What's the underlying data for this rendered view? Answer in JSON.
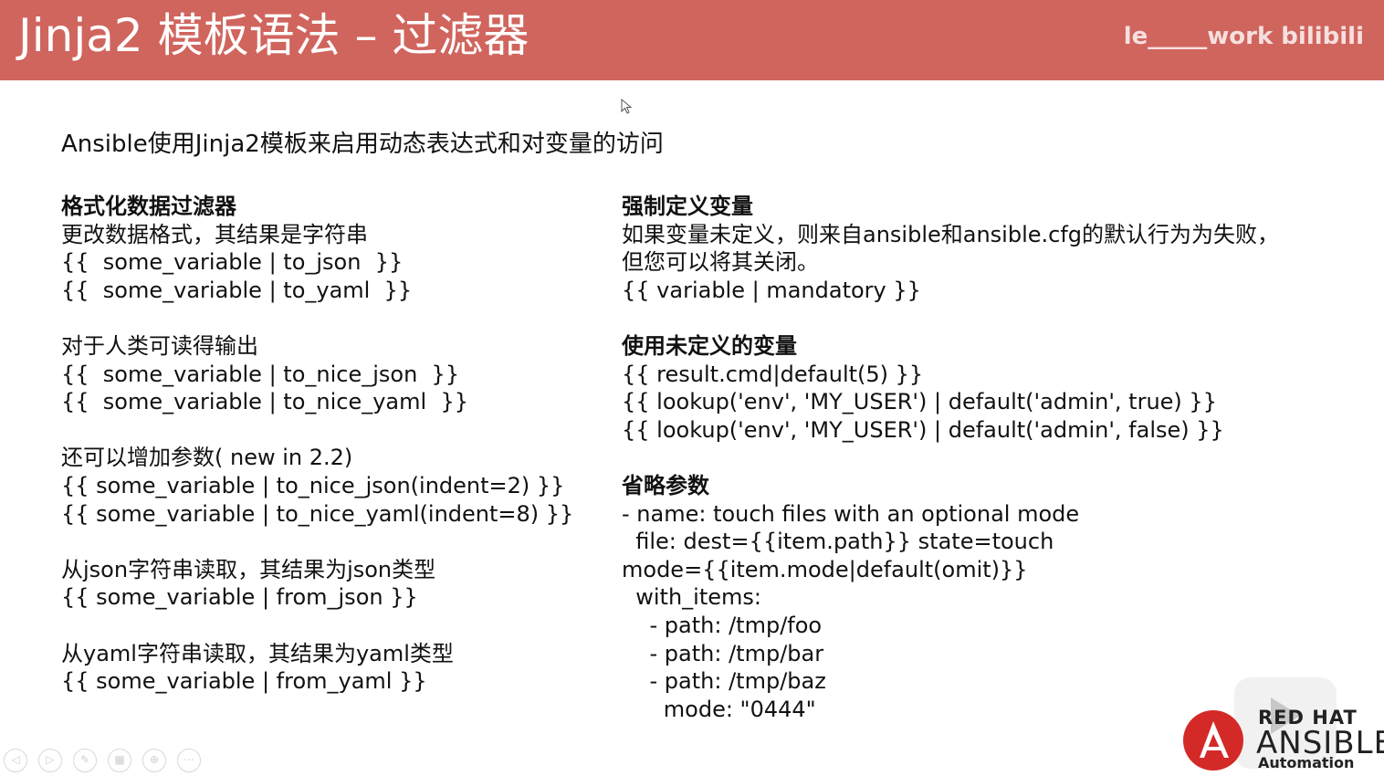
{
  "header": {
    "title": "Jinja2 模板语法 – 过滤器",
    "watermark": "le_____work bilibili",
    "background_color": "#d0655e"
  },
  "intro": "Ansible使用Jinja2模板来启用动态表达式和对变量的访问",
  "left_column": [
    {
      "text": "格式化数据过滤器",
      "kind": "heading"
    },
    {
      "text": "更改数据格式，其结果是字符串",
      "kind": "text"
    },
    {
      "text": "{{  some_variable | to_json  }}",
      "kind": "text"
    },
    {
      "text": "{{  some_variable | to_yaml  }}",
      "kind": "text"
    },
    {
      "text": "",
      "kind": "gap"
    },
    {
      "text": "对于人类可读得输出",
      "kind": "text"
    },
    {
      "text": "{{  some_variable | to_nice_json  }}",
      "kind": "text"
    },
    {
      "text": "{{  some_variable | to_nice_yaml  }}",
      "kind": "text"
    },
    {
      "text": "",
      "kind": "gap"
    },
    {
      "text": "还可以增加参数( new in 2.2)",
      "kind": "text"
    },
    {
      "text": "{{ some_variable | to_nice_json(indent=2) }}",
      "kind": "text"
    },
    {
      "text": "{{ some_variable | to_nice_yaml(indent=8) }}",
      "kind": "text"
    },
    {
      "text": "",
      "kind": "gap"
    },
    {
      "text": "从json字符串读取，其结果为json类型",
      "kind": "text"
    },
    {
      "text": "{{ some_variable | from_json }}",
      "kind": "text"
    },
    {
      "text": "",
      "kind": "gap"
    },
    {
      "text": "从yaml字符串读取，其结果为yaml类型",
      "kind": "text"
    },
    {
      "text": "{{ some_variable | from_yaml }}",
      "kind": "text"
    }
  ],
  "right_column": [
    {
      "text": "强制定义变量",
      "kind": "heading"
    },
    {
      "text": "如果变量未定义，则来自ansible和ansible.cfg的默认行为为失败，",
      "kind": "text"
    },
    {
      "text": "但您可以将其关闭。",
      "kind": "text"
    },
    {
      "text": "{{ variable | mandatory }}",
      "kind": "text"
    },
    {
      "text": "",
      "kind": "gap"
    },
    {
      "text": "使用未定义的变量",
      "kind": "heading"
    },
    {
      "text": "{{ result.cmd|default(5) }}",
      "kind": "text"
    },
    {
      "text": "{{ lookup('env', 'MY_USER') | default('admin', true) }}",
      "kind": "text"
    },
    {
      "text": "{{ lookup('env', 'MY_USER') | default('admin', false) }}",
      "kind": "text"
    },
    {
      "text": "",
      "kind": "gap"
    },
    {
      "text": "省略参数",
      "kind": "heading"
    },
    {
      "text": "- name: touch files with an optional mode",
      "kind": "text"
    },
    {
      "text": "  file: dest={{item.path}} state=touch",
      "kind": "text"
    },
    {
      "text": "mode={{item.mode|default(omit)}}",
      "kind": "text"
    },
    {
      "text": "  with_items:",
      "kind": "text"
    },
    {
      "text": "    - path: /tmp/foo",
      "kind": "text"
    },
    {
      "text": "    - path: /tmp/bar",
      "kind": "text"
    },
    {
      "text": "    - path: /tmp/baz",
      "kind": "text"
    },
    {
      "text": "      mode: \"0444\"",
      "kind": "text"
    }
  ],
  "logo": {
    "line1": "RED HAT",
    "line2": "ANSIBLE",
    "line3": "Automation",
    "mark": "A",
    "color": "#d32a28"
  },
  "nav_icons": [
    {
      "icon": "previous-icon",
      "glyph": "◁"
    },
    {
      "icon": "next-icon",
      "glyph": "▷"
    },
    {
      "icon": "pen-icon",
      "glyph": "✎"
    },
    {
      "icon": "slides-icon",
      "glyph": "▦"
    },
    {
      "icon": "zoom-icon",
      "glyph": "⊕"
    },
    {
      "icon": "more-icon",
      "glyph": "⋯"
    }
  ]
}
